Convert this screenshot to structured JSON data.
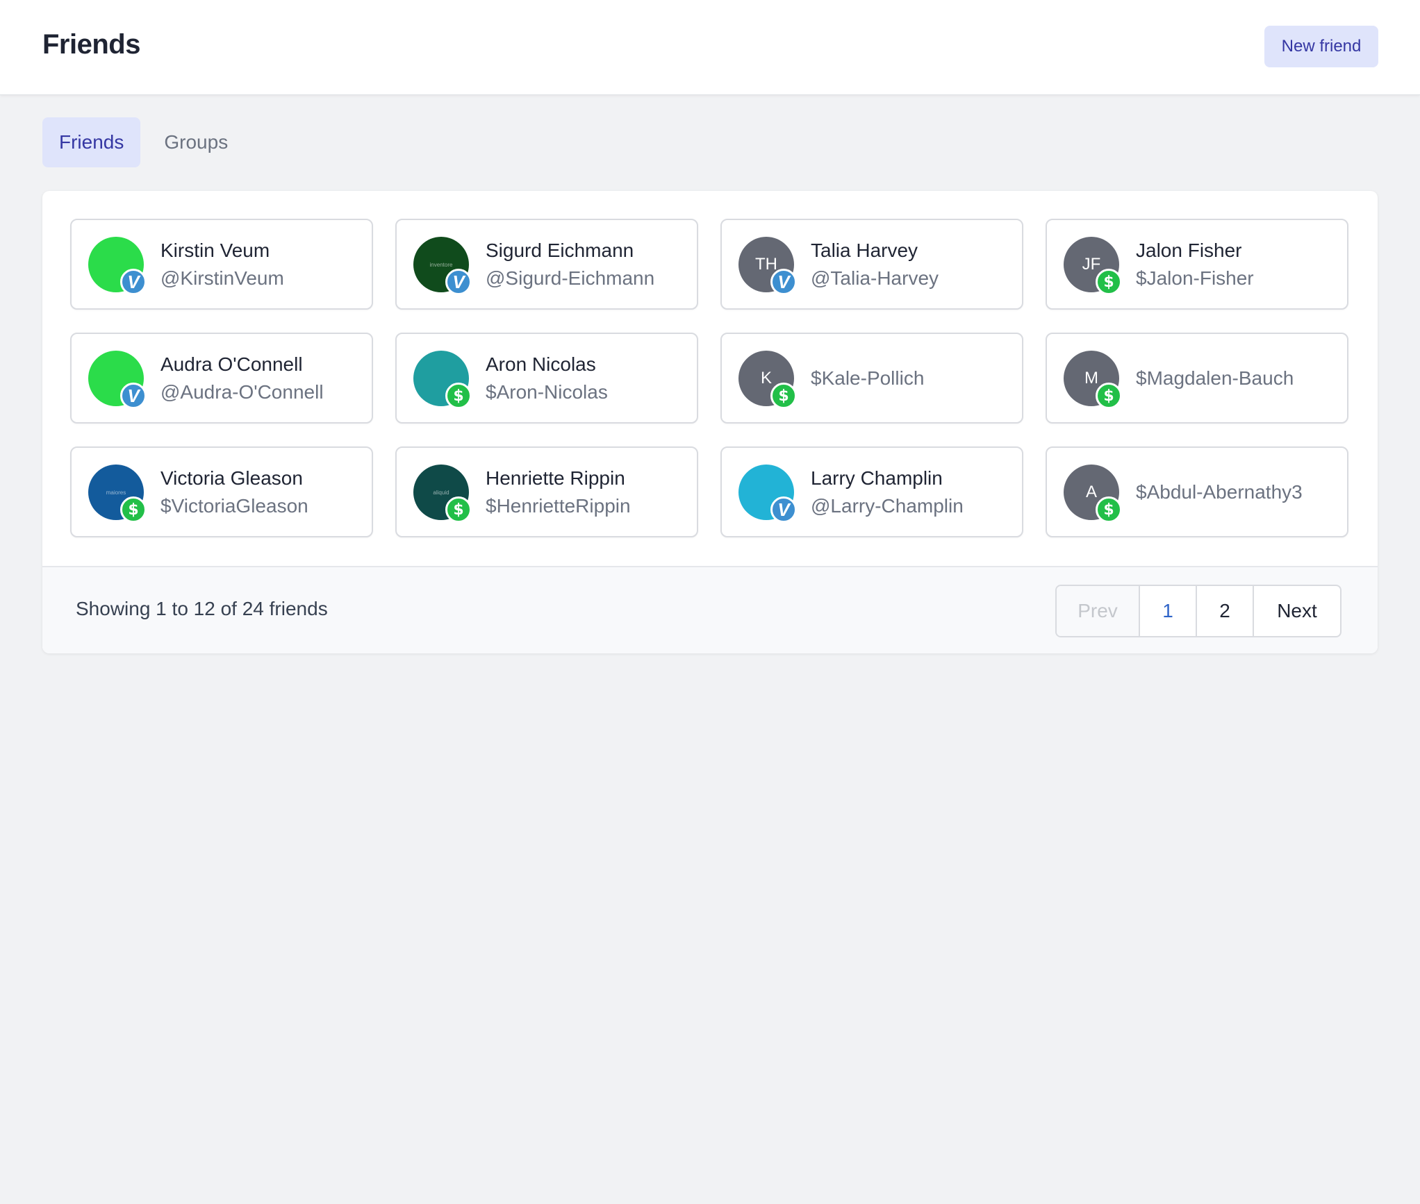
{
  "header": {
    "title": "Friends",
    "new_friend_label": "New friend"
  },
  "tabs": [
    {
      "label": "Friends",
      "active": true
    },
    {
      "label": "Groups",
      "active": false
    }
  ],
  "friends": [
    {
      "name": "Kirstin Veum",
      "handle": "@KirstinVeum",
      "avatar_text": "",
      "avatar_color": "#2bdc4a",
      "service": "venmo"
    },
    {
      "name": "Sigurd Eichmann",
      "handle": "@Sigurd-Eichmann",
      "avatar_text": "inventore",
      "avatar_color": "#104b1c",
      "service": "venmo"
    },
    {
      "name": "Talia Harvey",
      "handle": "@Talia-Harvey",
      "avatar_text": "TH",
      "avatar_color": "#646873",
      "service": "venmo"
    },
    {
      "name": "Jalon Fisher",
      "handle": "$Jalon-Fisher",
      "avatar_text": "JF",
      "avatar_color": "#646873",
      "service": "cash"
    },
    {
      "name": "Audra O'Connell",
      "handle": "@Audra-O'Connell",
      "avatar_text": "",
      "avatar_color": "#2bdc4a",
      "service": "venmo"
    },
    {
      "name": "Aron Nicolas",
      "handle": "$Aron-Nicolas",
      "avatar_text": "",
      "avatar_color": "#1f9ea0",
      "service": "cash"
    },
    {
      "name": "",
      "handle": "$Kale-Pollich",
      "avatar_text": "K",
      "avatar_color": "#646873",
      "service": "cash"
    },
    {
      "name": "",
      "handle": "$Magdalen-Bauch",
      "avatar_text": "M",
      "avatar_color": "#646873",
      "service": "cash"
    },
    {
      "name": "Victoria Gleason",
      "handle": "$VictoriaGleason",
      "avatar_text": "maiores",
      "avatar_color": "#135b9c",
      "service": "cash"
    },
    {
      "name": "Henriette Rippin",
      "handle": "$HenrietteRippin",
      "avatar_text": "aliquid",
      "avatar_color": "#0f4a48",
      "service": "cash"
    },
    {
      "name": "Larry Champlin",
      "handle": "@Larry-Champlin",
      "avatar_text": "",
      "avatar_color": "#22b3d6",
      "service": "venmo"
    },
    {
      "name": "",
      "handle": "$Abdul-Abernathy3",
      "avatar_text": "A",
      "avatar_color": "#646873",
      "service": "cash"
    }
  ],
  "badges": {
    "venmo": "V",
    "cash": "$"
  },
  "pagination": {
    "showing": "Showing 1 to 12 of 24 friends",
    "prev": "Prev",
    "pages": [
      "1",
      "2"
    ],
    "current": "1",
    "next": "Next"
  }
}
